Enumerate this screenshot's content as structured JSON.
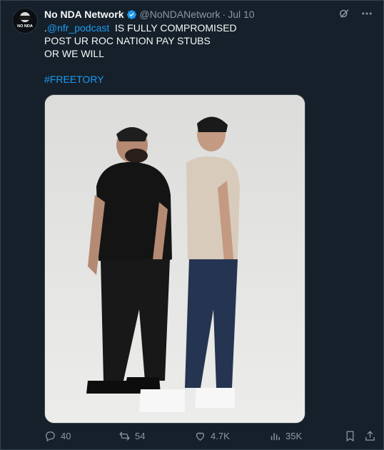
{
  "tweet": {
    "author": {
      "name": "No NDA Network",
      "handle": "@NoNDANetwork",
      "date": "Jul 10",
      "verified": true,
      "avatar_text": "NO NDA"
    },
    "separator": "·",
    "text": {
      "line1_prefix": ".",
      "mention": "@nfr_podcast",
      "line1_suffix": "  IS FULLY COMPROMISED",
      "line2": "POST UR ROC NATION PAY STUBS",
      "line3": "OR WE WILL",
      "hashtag": "#FREETORY"
    },
    "header_icons": [
      "grok-icon",
      "more-icon"
    ],
    "actions": {
      "replies": "40",
      "reposts": "54",
      "likes": "4.7K",
      "views": "35K"
    }
  },
  "colors": {
    "background": "#15202b",
    "accent": "#1d9bf0",
    "muted": "#8b98a5",
    "text": "#f7f9f9"
  }
}
